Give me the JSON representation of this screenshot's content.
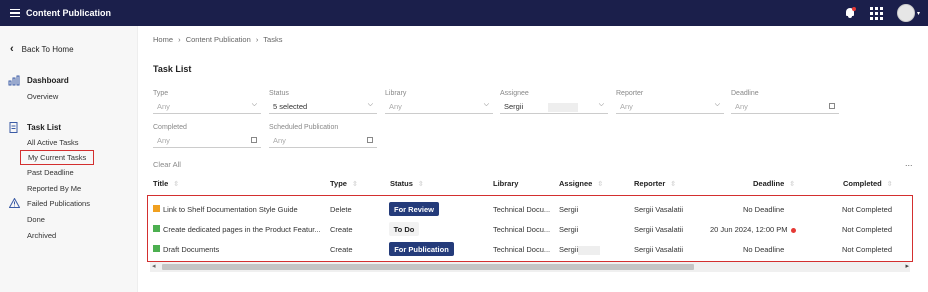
{
  "app": {
    "title": "Content Publication"
  },
  "sidebar": {
    "back_label": "Back To Home",
    "dashboard": {
      "label": "Dashboard",
      "items": [
        "Overview"
      ]
    },
    "task_list": {
      "label": "Task List",
      "items": [
        "All Active Tasks",
        "My Current Tasks",
        "Past Deadline",
        "Reported By Me"
      ]
    },
    "failed": {
      "label": "Failed Publications",
      "items": [
        "Done",
        "Archived"
      ]
    }
  },
  "breadcrumb": [
    "Home",
    "›",
    "Content Publication",
    "›",
    "Tasks"
  ],
  "page": {
    "title": "Task List"
  },
  "filters": {
    "type": {
      "label": "Type",
      "placeholder": "Any"
    },
    "status": {
      "label": "Status",
      "value": "5 selected"
    },
    "library": {
      "label": "Library",
      "placeholder": "Any"
    },
    "assignee": {
      "label": "Assignee",
      "value": "Sergii"
    },
    "reporter": {
      "label": "Reporter",
      "placeholder": "Any"
    },
    "deadline": {
      "label": "Deadline",
      "placeholder": "Any"
    },
    "completed": {
      "label": "Completed",
      "placeholder": "Any"
    },
    "scheduled": {
      "label": "Scheduled Publication",
      "placeholder": "Any"
    },
    "clear_all": "Clear All"
  },
  "table": {
    "more_label": "...",
    "headers": {
      "title": "Title",
      "type": "Type",
      "status": "Status",
      "library": "Library",
      "assignee": "Assignee",
      "reporter": "Reporter",
      "deadline": "Deadline",
      "completed": "Completed"
    },
    "rows": [
      {
        "icon_color": "#f0a020",
        "title": "Link to Shelf Documentation Style Guide",
        "type": "Delete",
        "status": "For Review",
        "library": "Technical Docu...",
        "assignee": "Sergii",
        "reporter": "Sergii Vasalatii",
        "deadline": "No Deadline",
        "completed": "Not Completed"
      },
      {
        "icon_color": "#4caf50",
        "title": "Create dedicated pages in the Product Featur...",
        "type": "Create",
        "status": "To Do",
        "library": "Technical Docu...",
        "assignee": "Sergii",
        "reporter": "Sergii Vasalatii",
        "deadline": "20 Jun 2024, 12:00 PM",
        "completed": "Not Completed"
      },
      {
        "icon_color": "#4caf50",
        "title": "Draft Documents",
        "type": "Create",
        "status": "For Publication",
        "library": "Technical Docu...",
        "assignee": "Sergii",
        "reporter": "Sergii Vasalatii",
        "deadline": "No Deadline",
        "completed": "Not Completed"
      }
    ]
  },
  "icons": {
    "menu": "hamburger-icon",
    "bell": "bell-icon",
    "apps": "apps-grid-icon",
    "user": "avatar",
    "back": "chevron-left-icon",
    "dashboard": "chart-icon",
    "tasks": "document-icon",
    "failed": "warning-icon"
  }
}
